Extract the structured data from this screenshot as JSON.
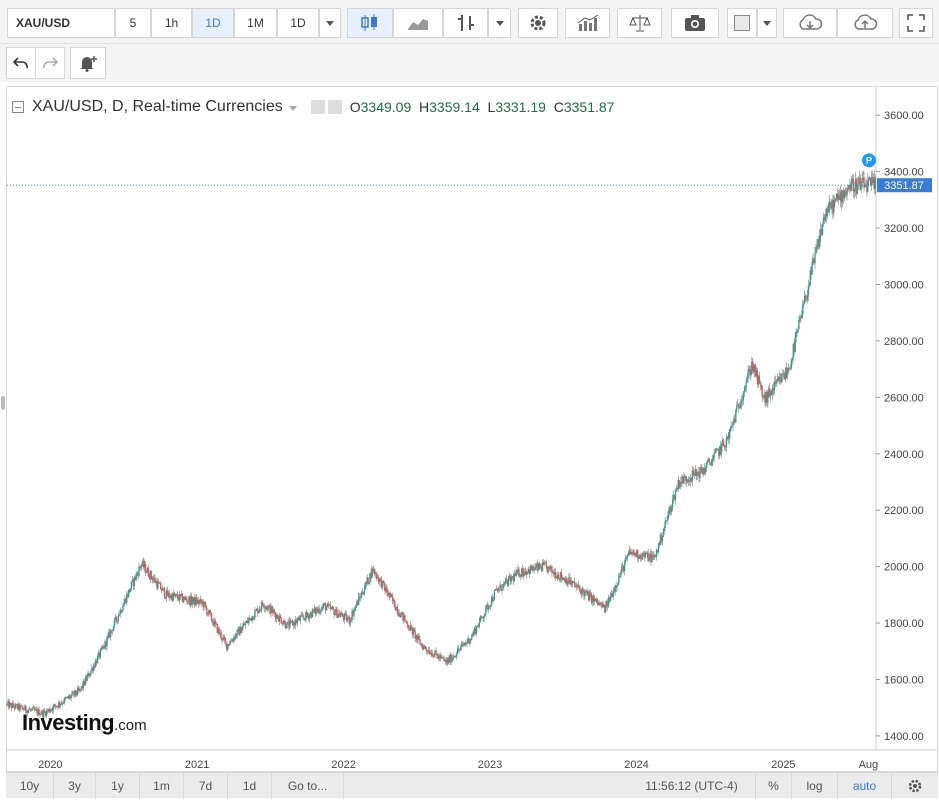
{
  "toolbar": {
    "symbol": "XAU/USD",
    "intervals": [
      "5",
      "1h",
      "1D",
      "1M",
      "1D"
    ],
    "active_interval_index": 2
  },
  "legend": {
    "title": "XAU/USD, D, Real-time Currencies",
    "open_label": "O",
    "open": "3349.09",
    "high_label": "H",
    "high": "3359.14",
    "low_label": "L",
    "low": "3331.19",
    "close_label": "C",
    "close": "3351.87"
  },
  "price_axis": {
    "ticks": [
      "3600.00",
      "3400.00",
      "3200.00",
      "3000.00",
      "2800.00",
      "2600.00",
      "2400.00",
      "2200.00",
      "2000.00",
      "1800.00",
      "1600.00",
      "1400.00"
    ],
    "current_price_label": "3351.87",
    "marker_label": "P"
  },
  "time_axis": {
    "ticks": [
      "2020",
      "2021",
      "2022",
      "2023",
      "2024",
      "2025",
      "Aug"
    ]
  },
  "bottom_bar": {
    "ranges": [
      "10y",
      "3y",
      "1y",
      "1m",
      "7d",
      "1d"
    ],
    "goto": "Go to...",
    "time": "11:56:12 (UTC-4)",
    "percent": "%",
    "log": "log",
    "auto": "auto"
  },
  "logo": {
    "main": "Investing",
    "suffix": ".com"
  },
  "colors": {
    "up": "#26a69a",
    "down": "#ef5350",
    "accent": "#3a7bd5"
  },
  "chart_data": {
    "type": "line",
    "x": [
      "2019-09",
      "2019-12",
      "2020-03",
      "2020-05",
      "2020-08",
      "2020-10",
      "2021-01",
      "2021-03",
      "2021-06",
      "2021-08",
      "2021-11",
      "2022-01",
      "2022-03",
      "2022-05",
      "2022-07",
      "2022-09",
      "2022-11",
      "2023-01",
      "2023-03",
      "2023-05",
      "2023-07",
      "2023-10",
      "2023-12",
      "2024-02",
      "2024-04",
      "2024-06",
      "2024-08",
      "2024-10",
      "2024-11",
      "2025-01",
      "2025-02",
      "2025-04",
      "2025-06",
      "2025-08"
    ],
    "series": [
      {
        "values": [
          1510,
          1480,
          1560,
          1720,
          2010,
          1900,
          1870,
          1720,
          1870,
          1790,
          1860,
          1810,
          1990,
          1850,
          1720,
          1660,
          1750,
          1910,
          1980,
          2000,
          1950,
          1850,
          2050,
          2030,
          2300,
          2340,
          2450,
          2720,
          2590,
          2700,
          2890,
          3250,
          3350,
          3352
        ]
      }
    ],
    "ylim": [
      1350,
      3700
    ]
  }
}
